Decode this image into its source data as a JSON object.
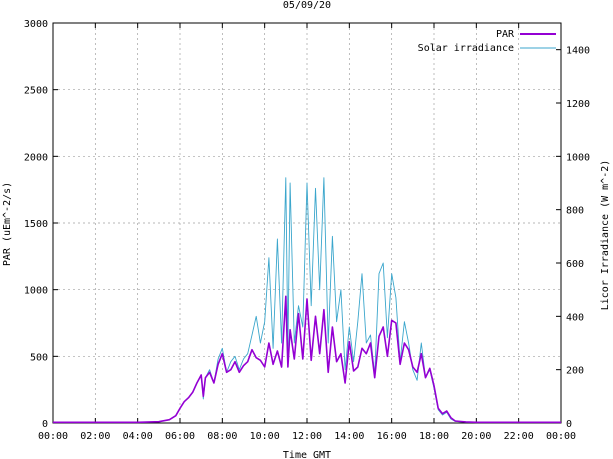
{
  "chart_data": {
    "type": "line",
    "title": "05/09/20",
    "xlabel": "Time GMT",
    "ylabel": "PAR (uEm^-2/s)",
    "y2label": "Licor Irradiance (W m^-2)",
    "xlim": [
      0,
      24
    ],
    "ylim": [
      0,
      3000
    ],
    "y2lim": [
      0,
      1500
    ],
    "x_tick_labels": [
      "00:00",
      "02:00",
      "04:00",
      "06:00",
      "08:00",
      "10:00",
      "12:00",
      "14:00",
      "16:00",
      "18:00",
      "20:00",
      "22:00",
      "00:00"
    ],
    "x_tick_values": [
      0,
      2,
      4,
      6,
      8,
      10,
      12,
      14,
      16,
      18,
      20,
      22,
      24
    ],
    "y_ticks": [
      0,
      500,
      1000,
      1500,
      2000,
      2500,
      3000
    ],
    "y2_ticks": [
      0,
      200,
      400,
      600,
      800,
      1000,
      1200,
      1400
    ],
    "grid": true,
    "legend": "top-right",
    "series": [
      {
        "name": "PAR",
        "axis": "left",
        "color": "#9400d3",
        "x": [
          0,
          4,
          5,
          5.5,
          5.8,
          6.0,
          6.2,
          6.4,
          6.6,
          6.8,
          7.0,
          7.1,
          7.2,
          7.4,
          7.6,
          7.8,
          8.0,
          8.2,
          8.4,
          8.6,
          8.8,
          9.0,
          9.2,
          9.4,
          9.6,
          9.8,
          10.0,
          10.2,
          10.4,
          10.6,
          10.8,
          11.0,
          11.1,
          11.2,
          11.4,
          11.6,
          11.8,
          12.0,
          12.2,
          12.4,
          12.6,
          12.8,
          13.0,
          13.2,
          13.4,
          13.6,
          13.8,
          14.0,
          14.2,
          14.4,
          14.6,
          14.8,
          15.0,
          15.2,
          15.4,
          15.6,
          15.8,
          16.0,
          16.2,
          16.4,
          16.6,
          16.8,
          17.0,
          17.2,
          17.4,
          17.6,
          17.8,
          18.0,
          18.2,
          18.4,
          18.6,
          18.8,
          19.0,
          19.5,
          20,
          24
        ],
        "y": [
          5,
          5,
          10,
          25,
          55,
          110,
          160,
          190,
          230,
          300,
          360,
          200,
          340,
          380,
          300,
          440,
          520,
          380,
          400,
          460,
          380,
          430,
          460,
          550,
          490,
          470,
          420,
          600,
          440,
          540,
          420,
          950,
          420,
          700,
          480,
          820,
          480,
          930,
          470,
          800,
          520,
          850,
          380,
          720,
          460,
          520,
          300,
          610,
          390,
          420,
          560,
          520,
          600,
          340,
          650,
          720,
          500,
          770,
          750,
          440,
          600,
          550,
          420,
          380,
          520,
          340,
          410,
          280,
          110,
          70,
          90,
          40,
          15,
          8,
          5,
          5
        ]
      },
      {
        "name": "Solar irradiance",
        "axis": "right",
        "color": "#3ba6cc",
        "x": [
          0,
          4,
          5,
          5.5,
          5.8,
          6.0,
          6.2,
          6.4,
          6.6,
          6.8,
          7.0,
          7.1,
          7.2,
          7.4,
          7.6,
          7.8,
          8.0,
          8.2,
          8.4,
          8.6,
          8.8,
          9.0,
          9.2,
          9.4,
          9.6,
          9.8,
          10.0,
          10.2,
          10.4,
          10.6,
          10.8,
          11.0,
          11.1,
          11.2,
          11.4,
          11.6,
          11.8,
          12.0,
          12.2,
          12.4,
          12.6,
          12.8,
          13.0,
          13.2,
          13.4,
          13.6,
          13.8,
          14.0,
          14.2,
          14.4,
          14.6,
          14.8,
          15.0,
          15.2,
          15.4,
          15.6,
          15.8,
          16.0,
          16.2,
          16.4,
          16.6,
          16.8,
          17.0,
          17.2,
          17.4,
          17.6,
          17.8,
          18.0,
          18.2,
          18.4,
          18.6,
          18.8,
          19.0,
          19.5,
          20,
          24
        ],
        "y": [
          2,
          2,
          5,
          12,
          28,
          55,
          80,
          95,
          115,
          150,
          180,
          90,
          170,
          200,
          150,
          240,
          280,
          190,
          230,
          250,
          200,
          240,
          260,
          330,
          400,
          300,
          380,
          620,
          280,
          690,
          300,
          920,
          280,
          900,
          300,
          440,
          360,
          900,
          440,
          880,
          500,
          920,
          300,
          700,
          380,
          500,
          200,
          360,
          230,
          380,
          560,
          300,
          330,
          180,
          560,
          600,
          320,
          560,
          470,
          230,
          380,
          300,
          200,
          160,
          300,
          170,
          200,
          130,
          50,
          30,
          40,
          15,
          6,
          3,
          2,
          2
        ]
      }
    ]
  }
}
